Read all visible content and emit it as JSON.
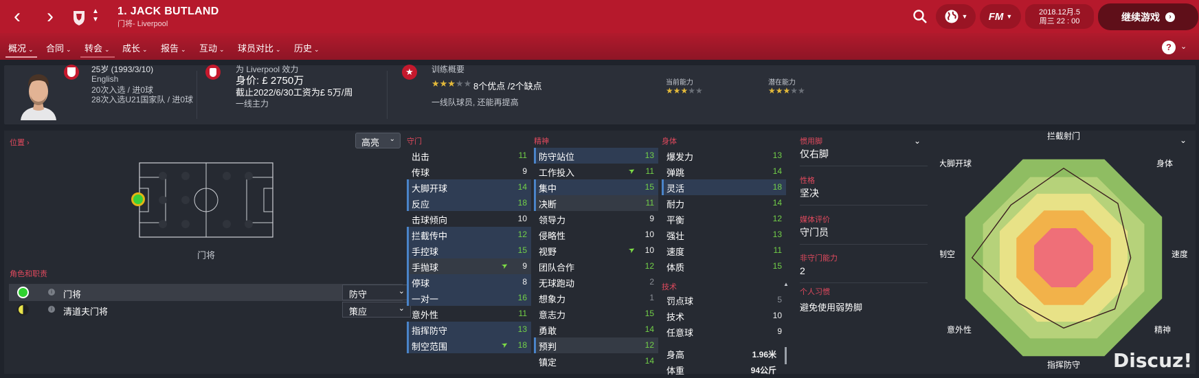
{
  "topbar": {
    "player_name": "1. JACK BUTLAND",
    "player_sub": "门将- Liverpool",
    "fm_label": "FM",
    "date_line1": "2018.12月.5",
    "date_line2": "周三 22 : 00",
    "continue_label": "继续游戏"
  },
  "subnav": {
    "items": [
      {
        "label": "概况"
      },
      {
        "label": "合同"
      },
      {
        "label": "转会"
      },
      {
        "label": "成长"
      },
      {
        "label": "报告"
      },
      {
        "label": "互动"
      },
      {
        "label": "球员对比"
      },
      {
        "label": "历史"
      }
    ]
  },
  "header": {
    "age": "25岁 (1993/3/10)",
    "nationality": "English",
    "caps": "20次入选 / 进0球",
    "u21_caps": "28次入选U21国家队 / 进0球",
    "plays_for": "为 Liverpool 效力",
    "value": "身价: £ 2750万",
    "contract": "截止2022/6/30工资为£ 5万/周",
    "squad_status": "一线主力",
    "training_title": "训练概要",
    "training_summary": "8个优点 /2个缺点",
    "training_note": "一线队球员, 还能再提高",
    "ca_label": "当前能力",
    "pa_label": "潜在能力",
    "ca_stars": 3,
    "pa_stars": 3,
    "training_stars": 3
  },
  "positions": {
    "title": "位置",
    "brightness": "高亮",
    "position_name": "门将"
  },
  "roles": {
    "title": "角色和职责",
    "items": [
      {
        "name": "门将",
        "duty": "防守"
      },
      {
        "name": "清道夫门将",
        "duty": "策应"
      }
    ]
  },
  "attributes": {
    "gk": {
      "title": "守门",
      "items": [
        {
          "name": "出击",
          "value": "11",
          "hl": false,
          "c": "g",
          "arrow": false
        },
        {
          "name": "传球",
          "value": "9",
          "hl": false,
          "c": "w",
          "arrow": false
        },
        {
          "name": "大脚开球",
          "value": "14",
          "hl": true,
          "c": "g",
          "arrow": false
        },
        {
          "name": "反应",
          "value": "18",
          "hl": true,
          "c": "g",
          "arrow": false
        },
        {
          "name": "击球倾向",
          "value": "10",
          "hl": false,
          "c": "w",
          "arrow": false
        },
        {
          "name": "拦截传中",
          "value": "12",
          "hl": true,
          "c": "g",
          "arrow": false
        },
        {
          "name": "手控球",
          "value": "15",
          "hl": true,
          "c": "g",
          "arrow": false
        },
        {
          "name": "手抛球",
          "value": "9",
          "hl": true,
          "c": "w",
          "arrow": true,
          "grey": true
        },
        {
          "name": "停球",
          "value": "8",
          "hl": true,
          "c": "w",
          "arrow": false
        },
        {
          "name": "一对一",
          "value": "16",
          "hl": true,
          "c": "g",
          "arrow": false
        },
        {
          "name": "意外性",
          "value": "11",
          "hl": false,
          "c": "g",
          "arrow": false
        },
        {
          "name": "指挥防守",
          "value": "13",
          "hl": true,
          "c": "g",
          "arrow": false
        },
        {
          "name": "制空范围",
          "value": "18",
          "hl": true,
          "c": "g",
          "arrow": true
        }
      ]
    },
    "mental": {
      "title": "精神",
      "items": [
        {
          "name": "防守站位",
          "value": "13",
          "hl": true,
          "c": "g",
          "arrow": false
        },
        {
          "name": "工作投入",
          "value": "11",
          "hl": false,
          "c": "g",
          "arrow": true
        },
        {
          "name": "集中",
          "value": "15",
          "hl": true,
          "c": "g",
          "arrow": false
        },
        {
          "name": "决断",
          "value": "11",
          "hl": true,
          "c": "g",
          "arrow": false,
          "grey": true
        },
        {
          "name": "领导力",
          "value": "9",
          "hl": false,
          "c": "w",
          "arrow": false
        },
        {
          "name": "侵略性",
          "value": "10",
          "hl": false,
          "c": "w",
          "arrow": false
        },
        {
          "name": "视野",
          "value": "10",
          "hl": false,
          "c": "w",
          "arrow": true
        },
        {
          "name": "团队合作",
          "value": "12",
          "hl": false,
          "c": "g",
          "arrow": false
        },
        {
          "name": "无球跑动",
          "value": "2",
          "hl": false,
          "c": "d",
          "arrow": false
        },
        {
          "name": "想象力",
          "value": "1",
          "hl": false,
          "c": "d",
          "arrow": false
        },
        {
          "name": "意志力",
          "value": "15",
          "hl": false,
          "c": "g",
          "arrow": false
        },
        {
          "name": "勇敢",
          "value": "14",
          "hl": false,
          "c": "g",
          "arrow": false
        },
        {
          "name": "预判",
          "value": "12",
          "hl": true,
          "c": "g",
          "arrow": false,
          "grey": true
        },
        {
          "name": "镇定",
          "value": "14",
          "hl": false,
          "c": "g",
          "arrow": false
        }
      ]
    },
    "physical": {
      "title": "身体",
      "items": [
        {
          "name": "爆发力",
          "value": "13",
          "hl": false,
          "c": "g",
          "arrow": false
        },
        {
          "name": "弹跳",
          "value": "14",
          "hl": false,
          "c": "g",
          "arrow": false
        },
        {
          "name": "灵活",
          "value": "18",
          "hl": true,
          "c": "g",
          "arrow": false
        },
        {
          "name": "耐力",
          "value": "14",
          "hl": false,
          "c": "g",
          "arrow": false
        },
        {
          "name": "平衡",
          "value": "12",
          "hl": false,
          "c": "g",
          "arrow": false
        },
        {
          "name": "强壮",
          "value": "13",
          "hl": false,
          "c": "g",
          "arrow": false
        },
        {
          "name": "速度",
          "value": "11",
          "hl": false,
          "c": "g",
          "arrow": false
        },
        {
          "name": "体质",
          "value": "15",
          "hl": false,
          "c": "g",
          "arrow": false
        }
      ]
    },
    "technical": {
      "title": "技术",
      "items": [
        {
          "name": "罚点球",
          "value": "5",
          "hl": false,
          "c": "d",
          "arrow": false
        },
        {
          "name": "技术",
          "value": "10",
          "hl": false,
          "c": "w",
          "arrow": false
        },
        {
          "name": "任意球",
          "value": "9",
          "hl": false,
          "c": "w",
          "arrow": false
        }
      ]
    },
    "info": [
      {
        "name": "身高",
        "value": "1.96米"
      },
      {
        "name": "体重",
        "value": "94公斤"
      }
    ]
  },
  "stats": {
    "foot_label": "惯用脚",
    "foot": "仅右脚",
    "personality_label": "性格",
    "personality": "坚决",
    "media_label": "媒体评价",
    "media": "守门员",
    "nongk_label": "非守门能力",
    "nongk": "2",
    "habits_label": "个人习惯",
    "habits": "避免使用弱势脚"
  },
  "radar": {
    "labels": [
      "拦截射门",
      "身体",
      "速度",
      "精神",
      "指挥防守",
      "意外性",
      "制空",
      "大脚开球"
    ],
    "values": [
      0.84,
      0.72,
      0.63,
      0.68,
      0.66,
      0.6,
      0.86,
      0.7
    ]
  },
  "watermark": "Discuz!",
  "colors": {
    "accent": "#b6192c",
    "green": "#73d148",
    "highlight": "#2f3d54"
  }
}
